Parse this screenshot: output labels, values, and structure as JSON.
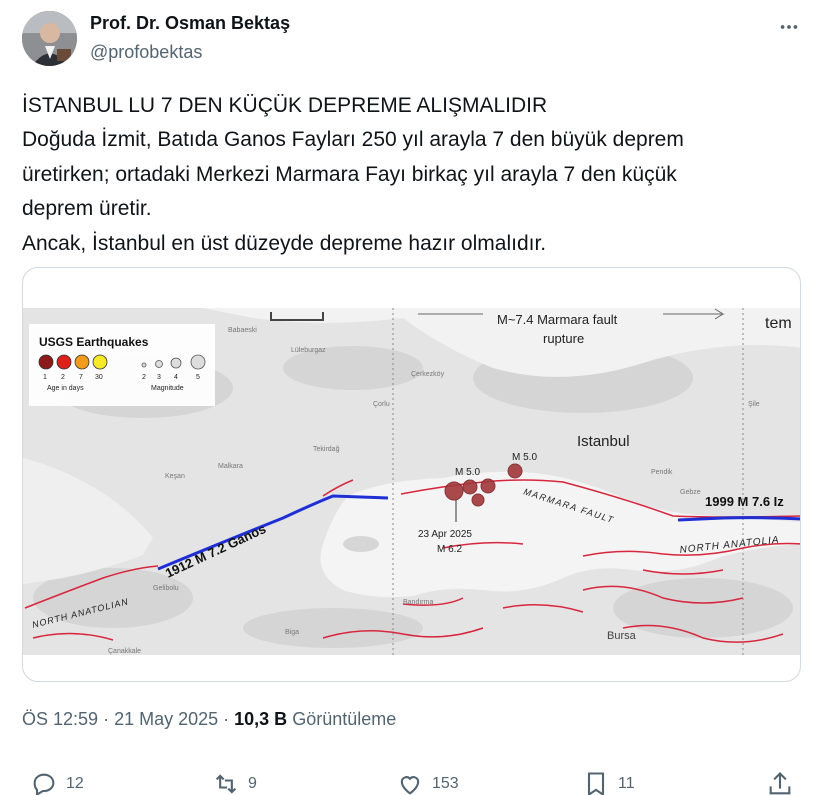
{
  "author": {
    "name": "Prof. Dr. Osman Bektaş",
    "handle": "@profobektas",
    "avatar_icon": "profile-photo-avatar"
  },
  "tweet": {
    "lines": [
      "İSTANBUL LU 7 DEN KÜÇÜK DEPREME ALIŞMALIDIR",
      "Doğuda İzmit, Batıda Ganos Fayları 250 yıl arayla 7 den büyük deprem",
      "üretirken; ortadaki Merkezi Marmara Fayı birkaç yıl arayla 7 den küçük",
      "deprem üretir.",
      "Ancak, İstanbul en üst düzeyde depreme hazır olmalıdır."
    ]
  },
  "map": {
    "legend": {
      "title": "USGS Earthquakes",
      "age_values": [
        "1",
        "2",
        "7",
        "30"
      ],
      "age_caption": "Age in days",
      "magnitude_values": [
        "2",
        "3",
        "4",
        "5"
      ],
      "magnitude_caption": "Magnitude",
      "age_colors": [
        "#8b1a1a",
        "#e0201c",
        "#f29b1d",
        "#f4ea2a"
      ]
    },
    "labels": {
      "rupture_line1": "M~7.4 Marmara fault",
      "rupture_line2": "rupture",
      "top_right_text": "tem",
      "istanbul": "Istanbul",
      "quake_a": "M 5.0",
      "quake_b": "M 5.0",
      "main_date": "23 Apr 2025",
      "main_mag": "M 6.2",
      "marmara_fault": "MARMARA FAULT",
      "ganos": "1912 M 7.2 Ganos",
      "north_anatolian_west": "NORTH ANATOLIAN",
      "quake_1999": "1999 M 7.6 Iz",
      "north_anatolian_east": "NORTH ANATOLIA",
      "town_babaeski": "Babaeski",
      "town_luleburgaz": "Lüleburgaz",
      "town_cerkezkoy": "Çerkezköy",
      "town_corlu": "Çorlu",
      "town_tekirdag": "Tekirdağ",
      "town_malkara": "Malkara",
      "town_kesan": "Keşan",
      "town_pendik": "Pendik",
      "town_gebze": "Gebze",
      "town_sile": "Şile",
      "town_bursa": "Bursa",
      "town_canakkale": "Çanakkale",
      "town_bandirma": "Bandırma",
      "town_biga": "Biga",
      "town_gelibolu": "Gelibolu"
    },
    "colors": {
      "ganos_fault": "#1f2fd6",
      "izmit_fault": "#1f2fd6",
      "active_faults": "#d7263d",
      "quake_fill": "#a3373a"
    }
  },
  "meta": {
    "time": "ÖS 12:59",
    "separator": " · ",
    "date": "21 May 2025",
    "views_count": "10,3 B",
    "views_label": "Görüntüleme"
  },
  "actions": {
    "reply_count": "12",
    "repost_count": "9",
    "like_count": "153",
    "bookmark_count": "11"
  }
}
